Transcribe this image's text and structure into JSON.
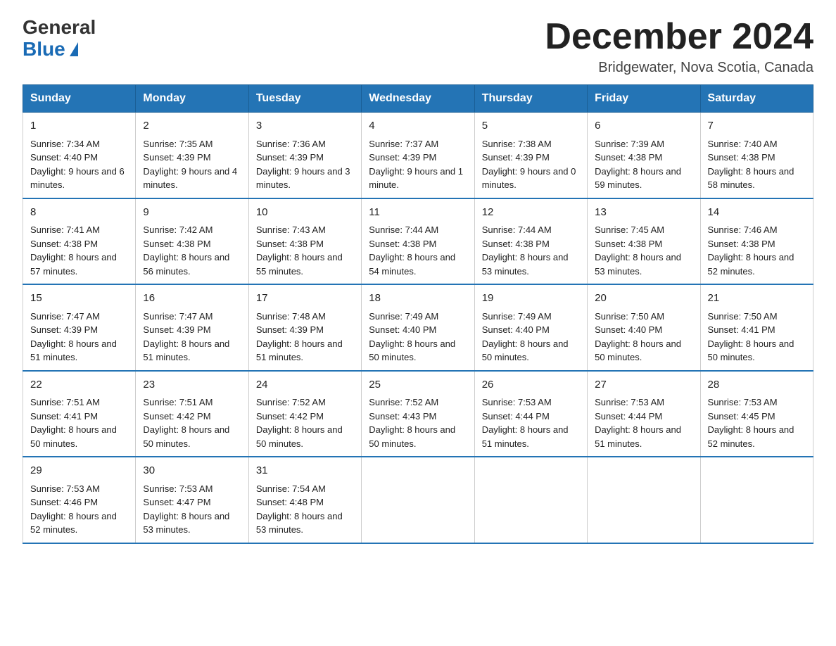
{
  "logo": {
    "general": "General",
    "blue": "Blue"
  },
  "header": {
    "month_title": "December 2024",
    "location": "Bridgewater, Nova Scotia, Canada"
  },
  "weekdays": [
    "Sunday",
    "Monday",
    "Tuesday",
    "Wednesday",
    "Thursday",
    "Friday",
    "Saturday"
  ],
  "weeks": [
    [
      {
        "day": "1",
        "sunrise": "7:34 AM",
        "sunset": "4:40 PM",
        "daylight": "9 hours and 6 minutes."
      },
      {
        "day": "2",
        "sunrise": "7:35 AM",
        "sunset": "4:39 PM",
        "daylight": "9 hours and 4 minutes."
      },
      {
        "day": "3",
        "sunrise": "7:36 AM",
        "sunset": "4:39 PM",
        "daylight": "9 hours and 3 minutes."
      },
      {
        "day": "4",
        "sunrise": "7:37 AM",
        "sunset": "4:39 PM",
        "daylight": "9 hours and 1 minute."
      },
      {
        "day": "5",
        "sunrise": "7:38 AM",
        "sunset": "4:39 PM",
        "daylight": "9 hours and 0 minutes."
      },
      {
        "day": "6",
        "sunrise": "7:39 AM",
        "sunset": "4:38 PM",
        "daylight": "8 hours and 59 minutes."
      },
      {
        "day": "7",
        "sunrise": "7:40 AM",
        "sunset": "4:38 PM",
        "daylight": "8 hours and 58 minutes."
      }
    ],
    [
      {
        "day": "8",
        "sunrise": "7:41 AM",
        "sunset": "4:38 PM",
        "daylight": "8 hours and 57 minutes."
      },
      {
        "day": "9",
        "sunrise": "7:42 AM",
        "sunset": "4:38 PM",
        "daylight": "8 hours and 56 minutes."
      },
      {
        "day": "10",
        "sunrise": "7:43 AM",
        "sunset": "4:38 PM",
        "daylight": "8 hours and 55 minutes."
      },
      {
        "day": "11",
        "sunrise": "7:44 AM",
        "sunset": "4:38 PM",
        "daylight": "8 hours and 54 minutes."
      },
      {
        "day": "12",
        "sunrise": "7:44 AM",
        "sunset": "4:38 PM",
        "daylight": "8 hours and 53 minutes."
      },
      {
        "day": "13",
        "sunrise": "7:45 AM",
        "sunset": "4:38 PM",
        "daylight": "8 hours and 53 minutes."
      },
      {
        "day": "14",
        "sunrise": "7:46 AM",
        "sunset": "4:38 PM",
        "daylight": "8 hours and 52 minutes."
      }
    ],
    [
      {
        "day": "15",
        "sunrise": "7:47 AM",
        "sunset": "4:39 PM",
        "daylight": "8 hours and 51 minutes."
      },
      {
        "day": "16",
        "sunrise": "7:47 AM",
        "sunset": "4:39 PM",
        "daylight": "8 hours and 51 minutes."
      },
      {
        "day": "17",
        "sunrise": "7:48 AM",
        "sunset": "4:39 PM",
        "daylight": "8 hours and 51 minutes."
      },
      {
        "day": "18",
        "sunrise": "7:49 AM",
        "sunset": "4:40 PM",
        "daylight": "8 hours and 50 minutes."
      },
      {
        "day": "19",
        "sunrise": "7:49 AM",
        "sunset": "4:40 PM",
        "daylight": "8 hours and 50 minutes."
      },
      {
        "day": "20",
        "sunrise": "7:50 AM",
        "sunset": "4:40 PM",
        "daylight": "8 hours and 50 minutes."
      },
      {
        "day": "21",
        "sunrise": "7:50 AM",
        "sunset": "4:41 PM",
        "daylight": "8 hours and 50 minutes."
      }
    ],
    [
      {
        "day": "22",
        "sunrise": "7:51 AM",
        "sunset": "4:41 PM",
        "daylight": "8 hours and 50 minutes."
      },
      {
        "day": "23",
        "sunrise": "7:51 AM",
        "sunset": "4:42 PM",
        "daylight": "8 hours and 50 minutes."
      },
      {
        "day": "24",
        "sunrise": "7:52 AM",
        "sunset": "4:42 PM",
        "daylight": "8 hours and 50 minutes."
      },
      {
        "day": "25",
        "sunrise": "7:52 AM",
        "sunset": "4:43 PM",
        "daylight": "8 hours and 50 minutes."
      },
      {
        "day": "26",
        "sunrise": "7:53 AM",
        "sunset": "4:44 PM",
        "daylight": "8 hours and 51 minutes."
      },
      {
        "day": "27",
        "sunrise": "7:53 AM",
        "sunset": "4:44 PM",
        "daylight": "8 hours and 51 minutes."
      },
      {
        "day": "28",
        "sunrise": "7:53 AM",
        "sunset": "4:45 PM",
        "daylight": "8 hours and 52 minutes."
      }
    ],
    [
      {
        "day": "29",
        "sunrise": "7:53 AM",
        "sunset": "4:46 PM",
        "daylight": "8 hours and 52 minutes."
      },
      {
        "day": "30",
        "sunrise": "7:53 AM",
        "sunset": "4:47 PM",
        "daylight": "8 hours and 53 minutes."
      },
      {
        "day": "31",
        "sunrise": "7:54 AM",
        "sunset": "4:48 PM",
        "daylight": "8 hours and 53 minutes."
      },
      null,
      null,
      null,
      null
    ]
  ],
  "labels": {
    "sunrise": "Sunrise:",
    "sunset": "Sunset:",
    "daylight": "Daylight:"
  }
}
